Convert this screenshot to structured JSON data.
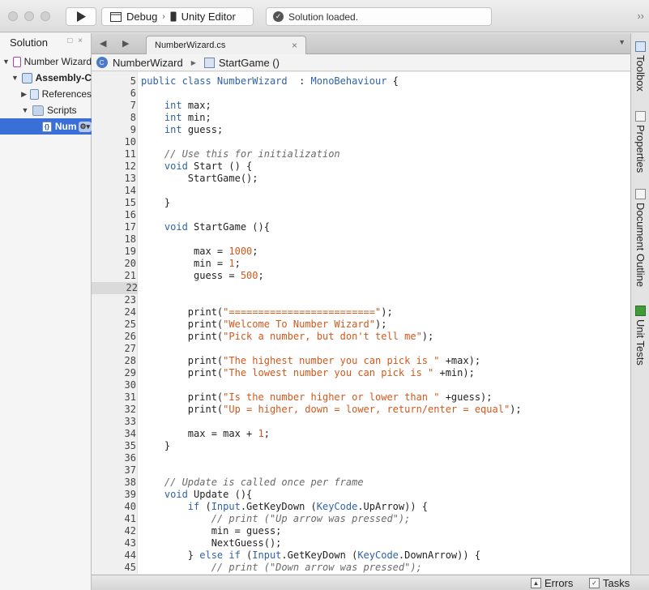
{
  "toolbar": {
    "config_label": "Debug",
    "target_label": "Unity Editor",
    "status_text": "Solution loaded."
  },
  "solution": {
    "title": "Solution",
    "header_controls": "□ ×",
    "items": [
      {
        "label": "Number Wizard"
      },
      {
        "label": "Assembly-C"
      },
      {
        "label": "References"
      },
      {
        "label": "Scripts"
      },
      {
        "label": "Num"
      }
    ]
  },
  "tabs": [
    {
      "label": "NumberWizard.cs"
    }
  ],
  "breadcrumb": {
    "class_name": "NumberWizard",
    "method_name": "StartGame ()"
  },
  "editor": {
    "current_line": 22,
    "lines": [
      {
        "n": "5",
        "tokens": [
          [
            "kw",
            "public class "
          ],
          [
            "ty",
            "NumberWizard"
          ],
          [
            "",
            "  : "
          ],
          [
            "ty",
            "MonoBehaviour"
          ],
          [
            "",
            " {"
          ]
        ]
      },
      {
        "n": "6",
        "tokens": []
      },
      {
        "n": "7",
        "tokens": [
          [
            "",
            "    "
          ],
          [
            "kw",
            "int"
          ],
          [
            "",
            " max;"
          ]
        ]
      },
      {
        "n": "8",
        "tokens": [
          [
            "",
            "    "
          ],
          [
            "kw",
            "int"
          ],
          [
            "",
            " min;"
          ]
        ]
      },
      {
        "n": "9",
        "tokens": [
          [
            "",
            "    "
          ],
          [
            "kw",
            "int"
          ],
          [
            "",
            " guess;"
          ]
        ]
      },
      {
        "n": "10",
        "tokens": []
      },
      {
        "n": "11",
        "tokens": [
          [
            "",
            "    "
          ],
          [
            "cm",
            "// Use this for initialization"
          ]
        ]
      },
      {
        "n": "12",
        "tokens": [
          [
            "",
            "    "
          ],
          [
            "kw",
            "void"
          ],
          [
            "",
            " Start () {"
          ]
        ]
      },
      {
        "n": "13",
        "tokens": [
          [
            "",
            "        StartGame();"
          ]
        ]
      },
      {
        "n": "14",
        "tokens": []
      },
      {
        "n": "15",
        "tokens": [
          [
            "",
            "    }"
          ]
        ]
      },
      {
        "n": "16",
        "tokens": []
      },
      {
        "n": "17",
        "tokens": [
          [
            "",
            "    "
          ],
          [
            "kw",
            "void"
          ],
          [
            "",
            " StartGame (){"
          ]
        ]
      },
      {
        "n": "18",
        "tokens": []
      },
      {
        "n": "19",
        "tokens": [
          [
            "",
            "         max = "
          ],
          [
            "nm",
            "1000"
          ],
          [
            "",
            ";"
          ]
        ]
      },
      {
        "n": "20",
        "tokens": [
          [
            "",
            "         min = "
          ],
          [
            "nm",
            "1"
          ],
          [
            "",
            ";"
          ]
        ]
      },
      {
        "n": "21",
        "tokens": [
          [
            "",
            "         guess = "
          ],
          [
            "nm",
            "500"
          ],
          [
            "",
            ";"
          ]
        ]
      },
      {
        "n": "22",
        "tokens": []
      },
      {
        "n": "23",
        "tokens": []
      },
      {
        "n": "24",
        "tokens": [
          [
            "",
            "        print("
          ],
          [
            "st",
            "\"=========================\""
          ],
          [
            "",
            ");"
          ]
        ]
      },
      {
        "n": "25",
        "tokens": [
          [
            "",
            "        print("
          ],
          [
            "st",
            "\"Welcome To Number Wizard\""
          ],
          [
            "",
            ");"
          ]
        ]
      },
      {
        "n": "26",
        "tokens": [
          [
            "",
            "        print("
          ],
          [
            "st",
            "\"Pick a number, but don't tell me\""
          ],
          [
            "",
            ");"
          ]
        ]
      },
      {
        "n": "27",
        "tokens": []
      },
      {
        "n": "28",
        "tokens": [
          [
            "",
            "        print("
          ],
          [
            "st",
            "\"The highest number you can pick is \""
          ],
          [
            "",
            " +max);"
          ]
        ]
      },
      {
        "n": "29",
        "tokens": [
          [
            "",
            "        print("
          ],
          [
            "st",
            "\"The lowest number you can pick is \""
          ],
          [
            "",
            " +min);"
          ]
        ]
      },
      {
        "n": "30",
        "tokens": []
      },
      {
        "n": "31",
        "tokens": [
          [
            "",
            "        print("
          ],
          [
            "st",
            "\"Is the number higher or lower than \""
          ],
          [
            "",
            " +guess);"
          ]
        ]
      },
      {
        "n": "32",
        "tokens": [
          [
            "",
            "        print("
          ],
          [
            "st",
            "\"Up = higher, down = lower, return/enter = equal\""
          ],
          [
            "",
            ");"
          ]
        ]
      },
      {
        "n": "33",
        "tokens": []
      },
      {
        "n": "34",
        "tokens": [
          [
            "",
            "        max = max + "
          ],
          [
            "nm",
            "1"
          ],
          [
            "",
            ";"
          ]
        ]
      },
      {
        "n": "35",
        "tokens": [
          [
            "",
            "    }"
          ]
        ]
      },
      {
        "n": "36",
        "tokens": []
      },
      {
        "n": "37",
        "tokens": []
      },
      {
        "n": "38",
        "tokens": [
          [
            "",
            "    "
          ],
          [
            "cm",
            "// Update is called once per frame"
          ]
        ]
      },
      {
        "n": "39",
        "tokens": [
          [
            "",
            "    "
          ],
          [
            "kw",
            "void"
          ],
          [
            "",
            " Update (){"
          ]
        ]
      },
      {
        "n": "40",
        "tokens": [
          [
            "",
            "        "
          ],
          [
            "kw",
            "if"
          ],
          [
            "",
            " ("
          ],
          [
            "ty",
            "Input"
          ],
          [
            "",
            ".GetKeyDown ("
          ],
          [
            "ty",
            "KeyCode"
          ],
          [
            "",
            ".UpArrow)) {"
          ]
        ]
      },
      {
        "n": "41",
        "tokens": [
          [
            "",
            "            "
          ],
          [
            "cm",
            "// print (\"Up arrow was pressed\");"
          ]
        ]
      },
      {
        "n": "42",
        "tokens": [
          [
            "",
            "            min = guess;"
          ]
        ]
      },
      {
        "n": "43",
        "tokens": [
          [
            "",
            "            NextGuess();"
          ]
        ]
      },
      {
        "n": "44",
        "tokens": [
          [
            "",
            "        } "
          ],
          [
            "kw",
            "else if"
          ],
          [
            "",
            " ("
          ],
          [
            "ty",
            "Input"
          ],
          [
            "",
            ".GetKeyDown ("
          ],
          [
            "ty",
            "KeyCode"
          ],
          [
            "",
            ".DownArrow)) {"
          ]
        ]
      },
      {
        "n": "45",
        "tokens": [
          [
            "",
            "            "
          ],
          [
            "cm",
            "// print (\"Down arrow was pressed\");"
          ]
        ]
      }
    ]
  },
  "right_dock": [
    {
      "label": "Toolbox"
    },
    {
      "label": "Properties"
    },
    {
      "label": "Document Outline"
    },
    {
      "label": "Unit Tests"
    }
  ],
  "bottom": {
    "errors_label": "Errors",
    "tasks_label": "Tasks"
  }
}
